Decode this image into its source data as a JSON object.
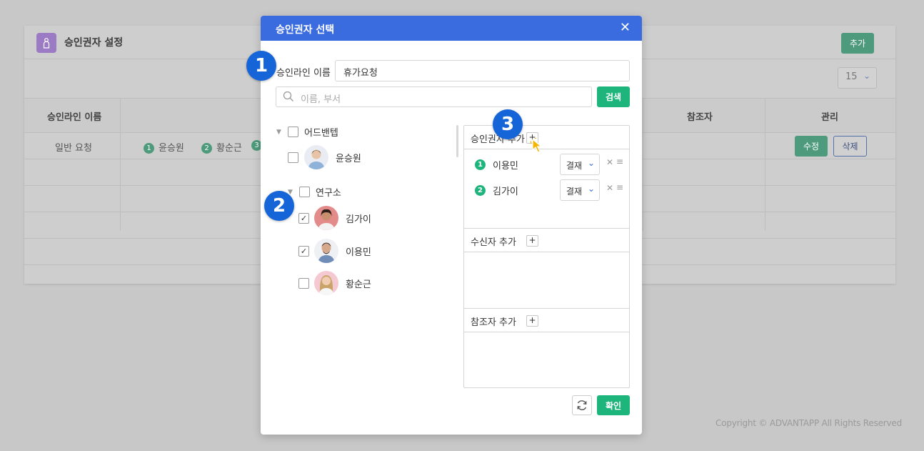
{
  "background": {
    "title": "승인권자 설정",
    "add_button": "추가",
    "page_size": "15",
    "columns": [
      "승인라인 이름",
      "참조자",
      "관리"
    ],
    "row": {
      "name": "일반 요청",
      "approvers": [
        {
          "badge": "1",
          "name": "윤승원"
        },
        {
          "badge": "2",
          "name": "황순근"
        },
        {
          "badge": "3",
          "name": ""
        }
      ],
      "edit": "수정",
      "delete": "삭제"
    },
    "copyright": "Copyright © ADVANTAPP All Rights Reserved"
  },
  "modal": {
    "title": "승인권자 선택",
    "close": "✕",
    "line_label": "승인라인 이름",
    "line_value": "휴가요청",
    "search_placeholder": "이름, 부서",
    "search_button": "검색",
    "tree": [
      {
        "dept": "어드밴텝",
        "members": [
          {
            "name": "윤승원",
            "checked": false
          }
        ]
      },
      {
        "dept": "연구소",
        "members": [
          {
            "name": "김가이",
            "checked": true
          },
          {
            "name": "이용민",
            "checked": true
          },
          {
            "name": "황순근",
            "checked": false
          }
        ]
      }
    ],
    "approver_section": "승인권자 추가",
    "approvers": [
      {
        "badge": "1",
        "name": "이용민",
        "type": "결재"
      },
      {
        "badge": "2",
        "name": "김가이",
        "type": "결재"
      }
    ],
    "receiver_section": "수신자 추가",
    "reference_section": "참조자 추가",
    "confirm_button": "확인",
    "plus": "+",
    "remove": "✕",
    "drag": "≡"
  },
  "steps": [
    "1",
    "2",
    "3"
  ],
  "colors": {
    "primary": "#3a6ce0",
    "accent": "#1eb57d",
    "step": "#1565d8"
  }
}
